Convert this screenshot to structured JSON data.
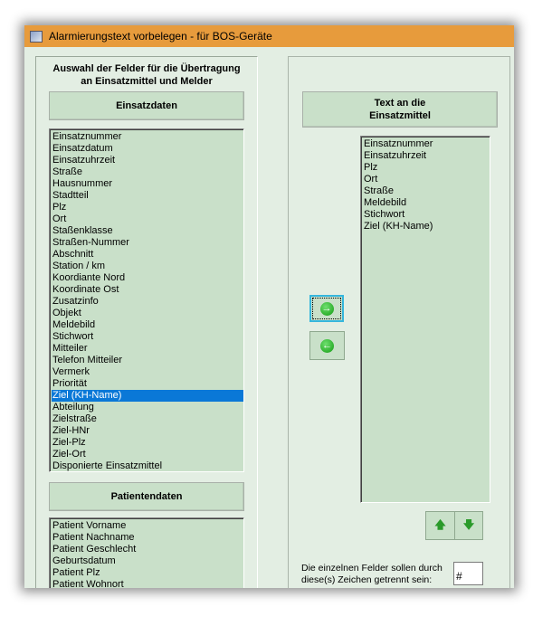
{
  "window": {
    "title": "Alarmierungstext vorbelegen - für BOS-Geräte"
  },
  "left": {
    "heading_line1": "Auswahl der Felder für die Übertragung",
    "heading_line2": "an Einsatzmittel und Melder",
    "einsatzdaten_label": "Einsatzdaten",
    "einsatzdaten_items": [
      "Einsatznummer",
      "Einsatzdatum",
      "Einsatzuhrzeit",
      "Straße",
      "Hausnummer",
      "Stadtteil",
      "Plz",
      "Ort",
      "Staßenklasse",
      "Straßen-Nummer",
      "Abschnitt",
      "Station / km",
      "Koordiante Nord",
      "Koordinate Ost",
      "Zusatzinfo",
      "Objekt",
      "Meldebild",
      "Stichwort",
      "Mitteiler",
      "Telefon Mitteiler",
      "Vermerk",
      "Priorität",
      "Ziel (KH-Name)",
      "Abteilung",
      "Zielstraße",
      "Ziel-HNr",
      "Ziel-Plz",
      "Ziel-Ort",
      "Disponierte Einsatzmittel"
    ],
    "selected_item": "Ziel (KH-Name)",
    "patientendaten_label": "Patientendaten",
    "patientendaten_items": [
      "Patient Vorname",
      "Patient Nachname",
      "Patient Geschlecht",
      "Geburtsdatum",
      "Patient Plz",
      "Patient Wohnort"
    ]
  },
  "right": {
    "header_line1": "Text an die",
    "header_line2": "Einsatzmittel",
    "items": [
      "Einsatznummer",
      "Einsatzuhrzeit",
      "Plz",
      "Ort",
      "Straße",
      "Meldebild",
      "Stichwort",
      "Ziel (KH-Name)"
    ],
    "separator_label_line1": "Die einzelnen Felder sollen durch",
    "separator_label_line2": "diese(s) Zeichen getrennt sein:",
    "separator_value": "#"
  },
  "icons": {
    "add": "arrow-right-circle-icon",
    "remove": "arrow-left-circle-icon",
    "up": "arrow-up-icon",
    "down": "arrow-down-icon"
  },
  "colors": {
    "titlebar": "#e79b3c",
    "list_bg": "#c9e0c9",
    "selection": "#0a78d7"
  }
}
